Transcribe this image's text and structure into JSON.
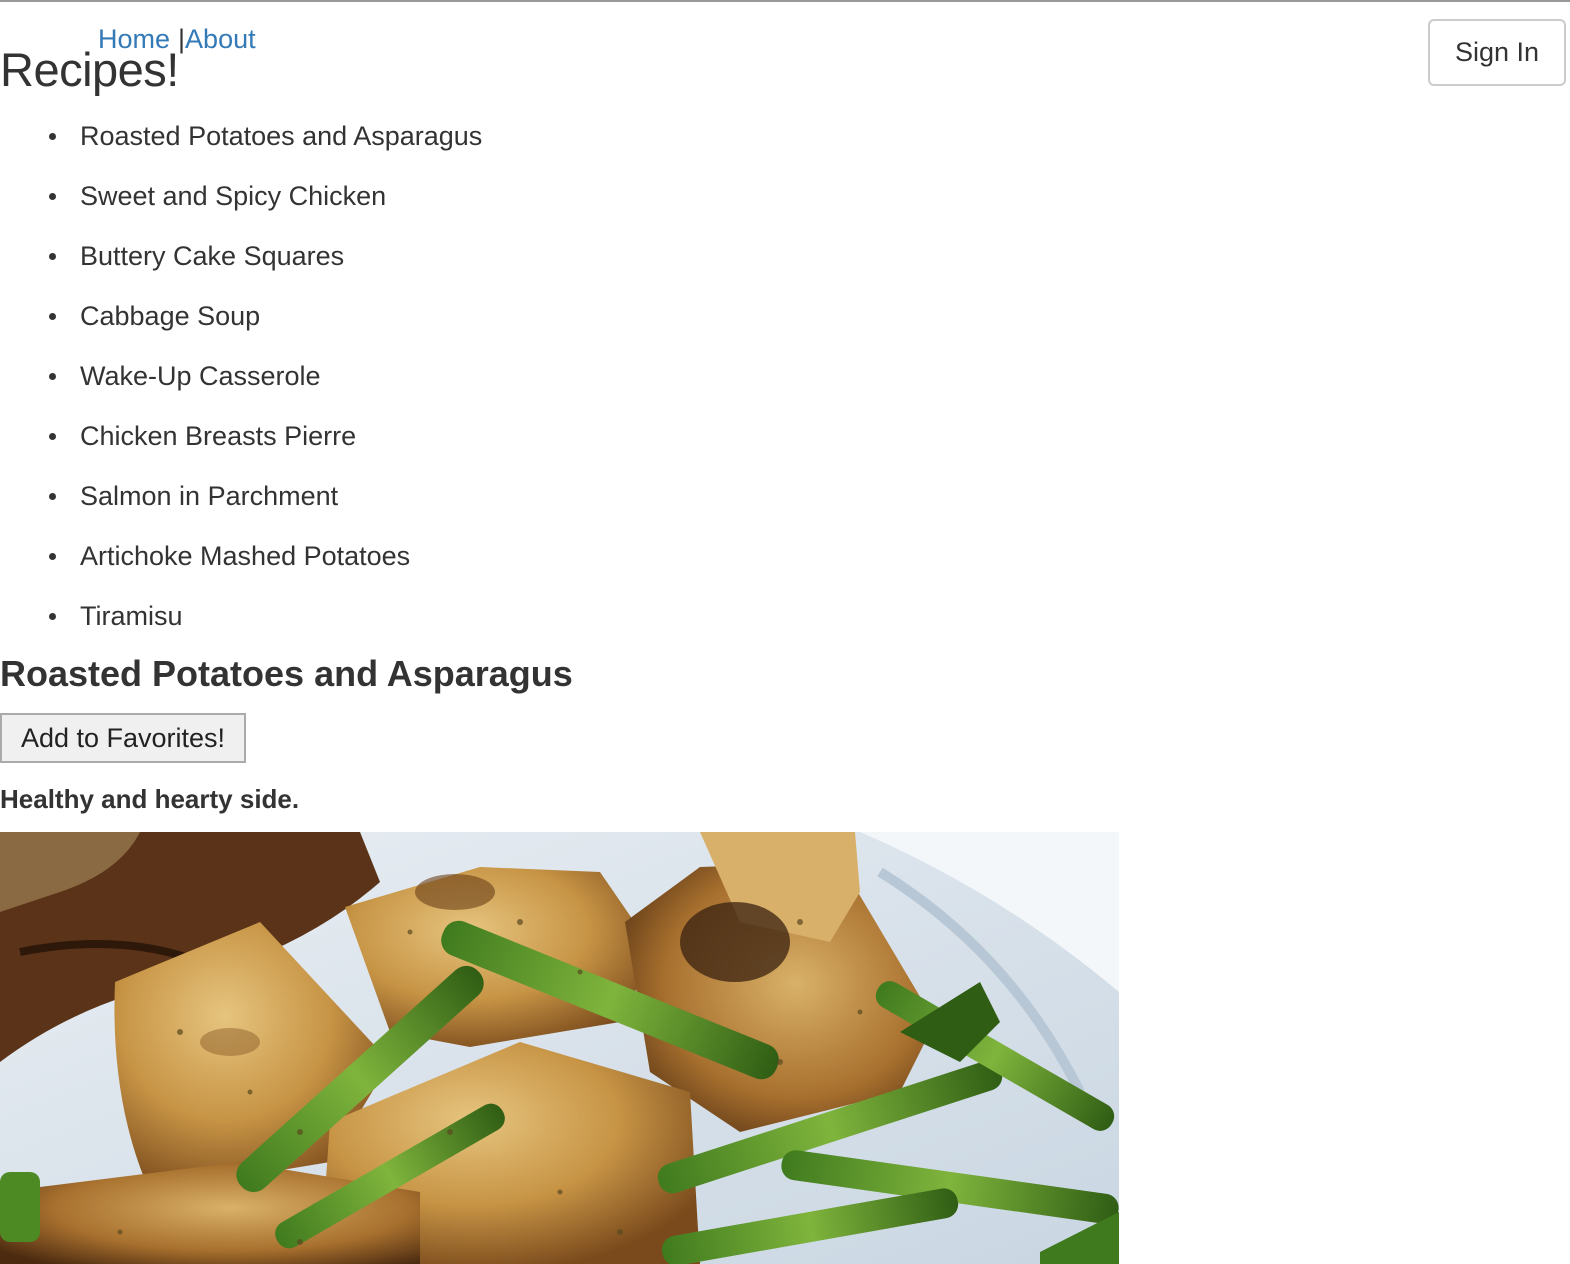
{
  "nav": {
    "home": "Home",
    "about": "About"
  },
  "page_title": "Recipes!",
  "signin_label": "Sign In",
  "recipes": [
    "Roasted Potatoes and Asparagus",
    "Sweet and Spicy Chicken",
    "Buttery Cake Squares",
    "Cabbage Soup",
    "Wake-Up Casserole",
    "Chicken Breasts Pierre",
    "Salmon in Parchment",
    "Artichoke Mashed Potatoes",
    "Tiramisu"
  ],
  "selected_recipe": {
    "title": "Roasted Potatoes and Asparagus",
    "favorite_button": "Add to Favorites!",
    "description": "Healthy and hearty side."
  },
  "colors": {
    "link": "#337ab7",
    "text": "#333333"
  }
}
